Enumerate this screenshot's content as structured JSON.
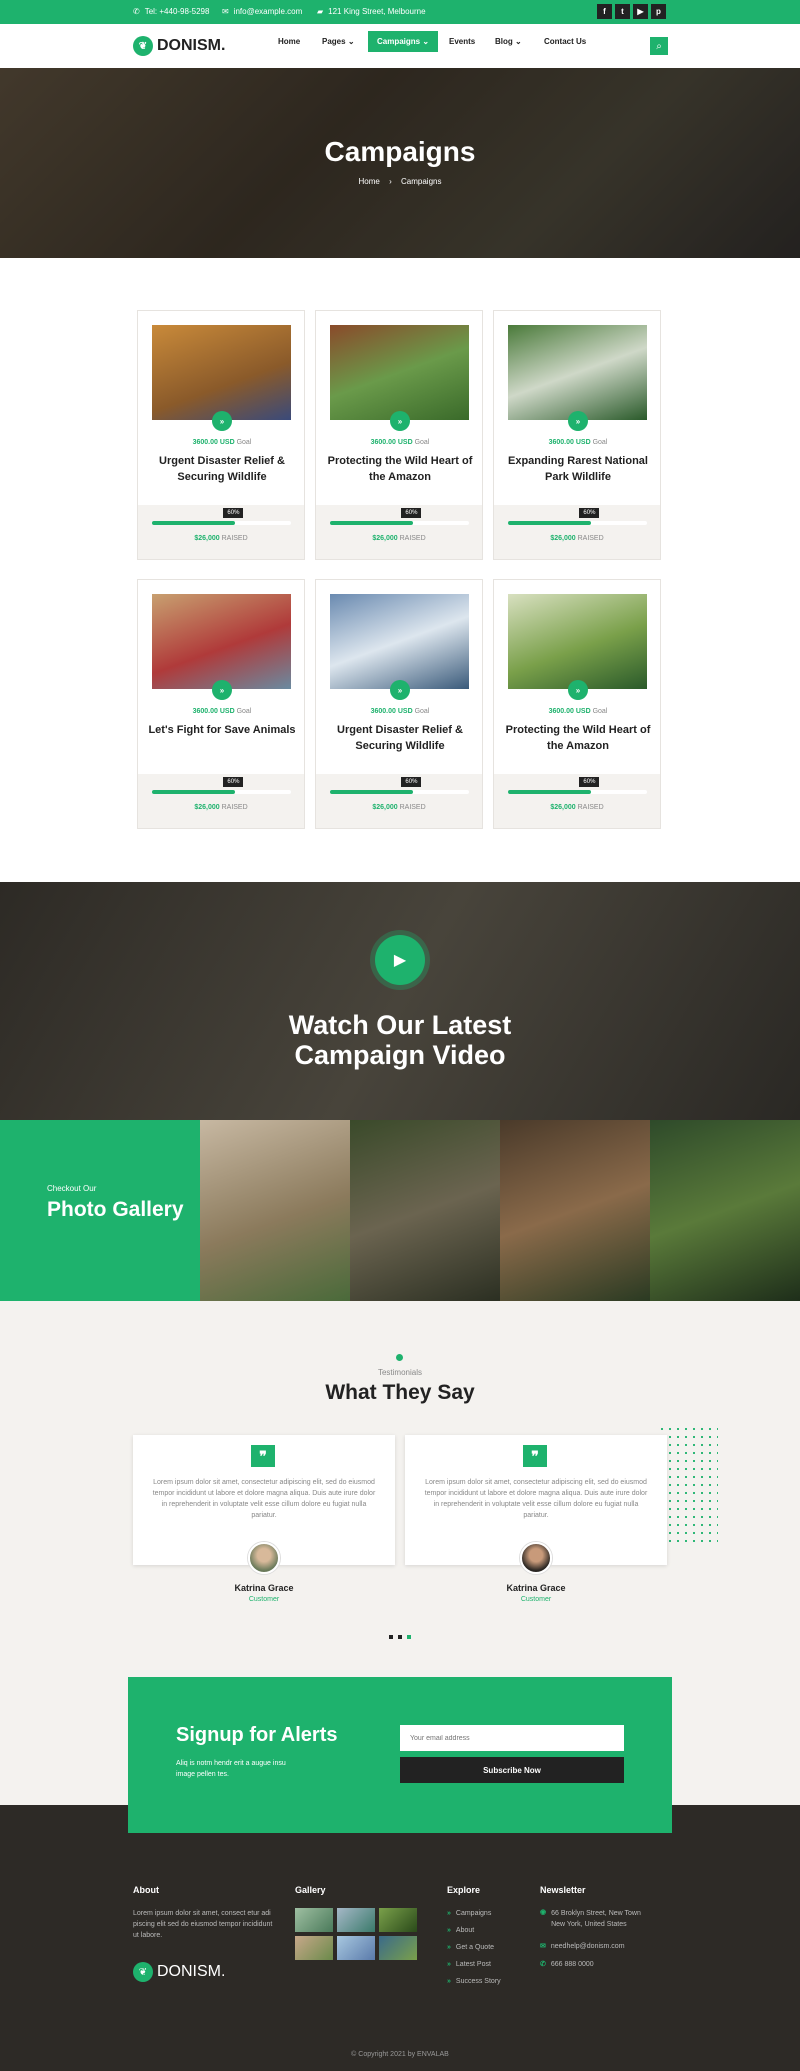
{
  "topbar": {
    "phone": "Tel: +440-98-5298",
    "email": "info@example.com",
    "address": "121 King Street, Melbourne",
    "social": [
      {
        "icon": "facebook-icon",
        "glyph": "f"
      },
      {
        "icon": "twitter-icon",
        "glyph": "t"
      },
      {
        "icon": "youtube-icon",
        "glyph": "▶"
      },
      {
        "icon": "pinterest-icon",
        "glyph": "p"
      }
    ]
  },
  "nav": {
    "logo": "DONISM.",
    "items": [
      "Home",
      "Pages",
      "Campaigns",
      "Events",
      "Blog",
      "Contact Us"
    ],
    "active": "Campaigns"
  },
  "hero": {
    "title": "Campaigns",
    "crumb_home": "Home",
    "crumb_current": "Campaigns"
  },
  "cards": [
    {
      "goal_amount": "3600.00 USD",
      "goal_label": "Goal",
      "title": "Urgent Disaster Relief & Securing Wildlife",
      "percent": "60%",
      "progress": 0.6,
      "raised_amount": "$26,000",
      "raised_label": "RAISED"
    },
    {
      "goal_amount": "3600.00 USD",
      "goal_label": "Goal",
      "title": "Protecting the Wild Heart of the Amazon",
      "percent": "60%",
      "progress": 0.6,
      "raised_amount": "$26,000",
      "raised_label": "RAISED"
    },
    {
      "goal_amount": "3600.00 USD",
      "goal_label": "Goal",
      "title": "Expanding Rarest National Park Wildlife",
      "percent": "60%",
      "progress": 0.6,
      "raised_amount": "$26,000",
      "raised_label": "RAISED"
    },
    {
      "goal_amount": "3600.00 USD",
      "goal_label": "Goal",
      "title": "Let's Fight for Save Animals",
      "percent": "60%",
      "progress": 0.6,
      "raised_amount": "$26,000",
      "raised_label": "RAISED"
    },
    {
      "goal_amount": "3600.00 USD",
      "goal_label": "Goal",
      "title": "Urgent Disaster Relief & Securing Wildlife",
      "percent": "60%",
      "progress": 0.6,
      "raised_amount": "$26,000",
      "raised_label": "RAISED"
    },
    {
      "goal_amount": "3600.00 USD",
      "goal_label": "Goal",
      "title": "Protecting the Wild Heart of the Amazon",
      "percent": "60%",
      "progress": 0.6,
      "raised_amount": "$26,000",
      "raised_label": "RAISED"
    }
  ],
  "video": {
    "title_line1": "Watch Our Latest",
    "title_line2": "Campaign Video"
  },
  "gallery": {
    "eyebrow": "Checkout Our",
    "title": "Photo Gallery"
  },
  "testimonials": {
    "eyebrow": "Testimonials",
    "title": "What They Say",
    "items": [
      {
        "text": "Lorem ipsum dolor sit amet, consectetur adipiscing elit, sed do eiusmod tempor incididunt ut labore et dolore magna aliqua. Duis aute irure dolor in reprehenderit in voluptate velit esse cillum dolore eu fugiat nulla pariatur.",
        "name": "Katrina Grace",
        "role": "Customer"
      },
      {
        "text": "Lorem ipsum dolor sit amet, consectetur adipiscing elit, sed do eiusmod tempor incididunt ut labore et dolore magna aliqua. Duis aute irure dolor in reprehenderit in voluptate velit esse cillum dolore eu fugiat nulla pariatur.",
        "name": "Katrina Grace",
        "role": "Customer"
      }
    ]
  },
  "signup": {
    "title": "Signup for Alerts",
    "subtitle": "Aliq is notm hendr erit a augue insu image pellen tes.",
    "placeholder": "Your email address",
    "button": "Subscribe Now"
  },
  "footer": {
    "about_title": "About",
    "about_text": "Lorem ipsum dolor sit amet, consect etur adi piscing elit sed do eiusmod tempor incididunt ut labore.",
    "logo": "DONISM.",
    "gallery_title": "Gallery",
    "explore_title": "Explore",
    "explore": [
      "Campaigns",
      "About",
      "Get a Quote",
      "Latest Post",
      "Success Story"
    ],
    "newsletter_title": "Newsletter",
    "address": "66 Broklyn Street, New Town New York, United States",
    "email": "needhelp@donism.com",
    "phone": "666 888 0000",
    "copyright": "© Copyright 2021 by ENVALAB"
  }
}
